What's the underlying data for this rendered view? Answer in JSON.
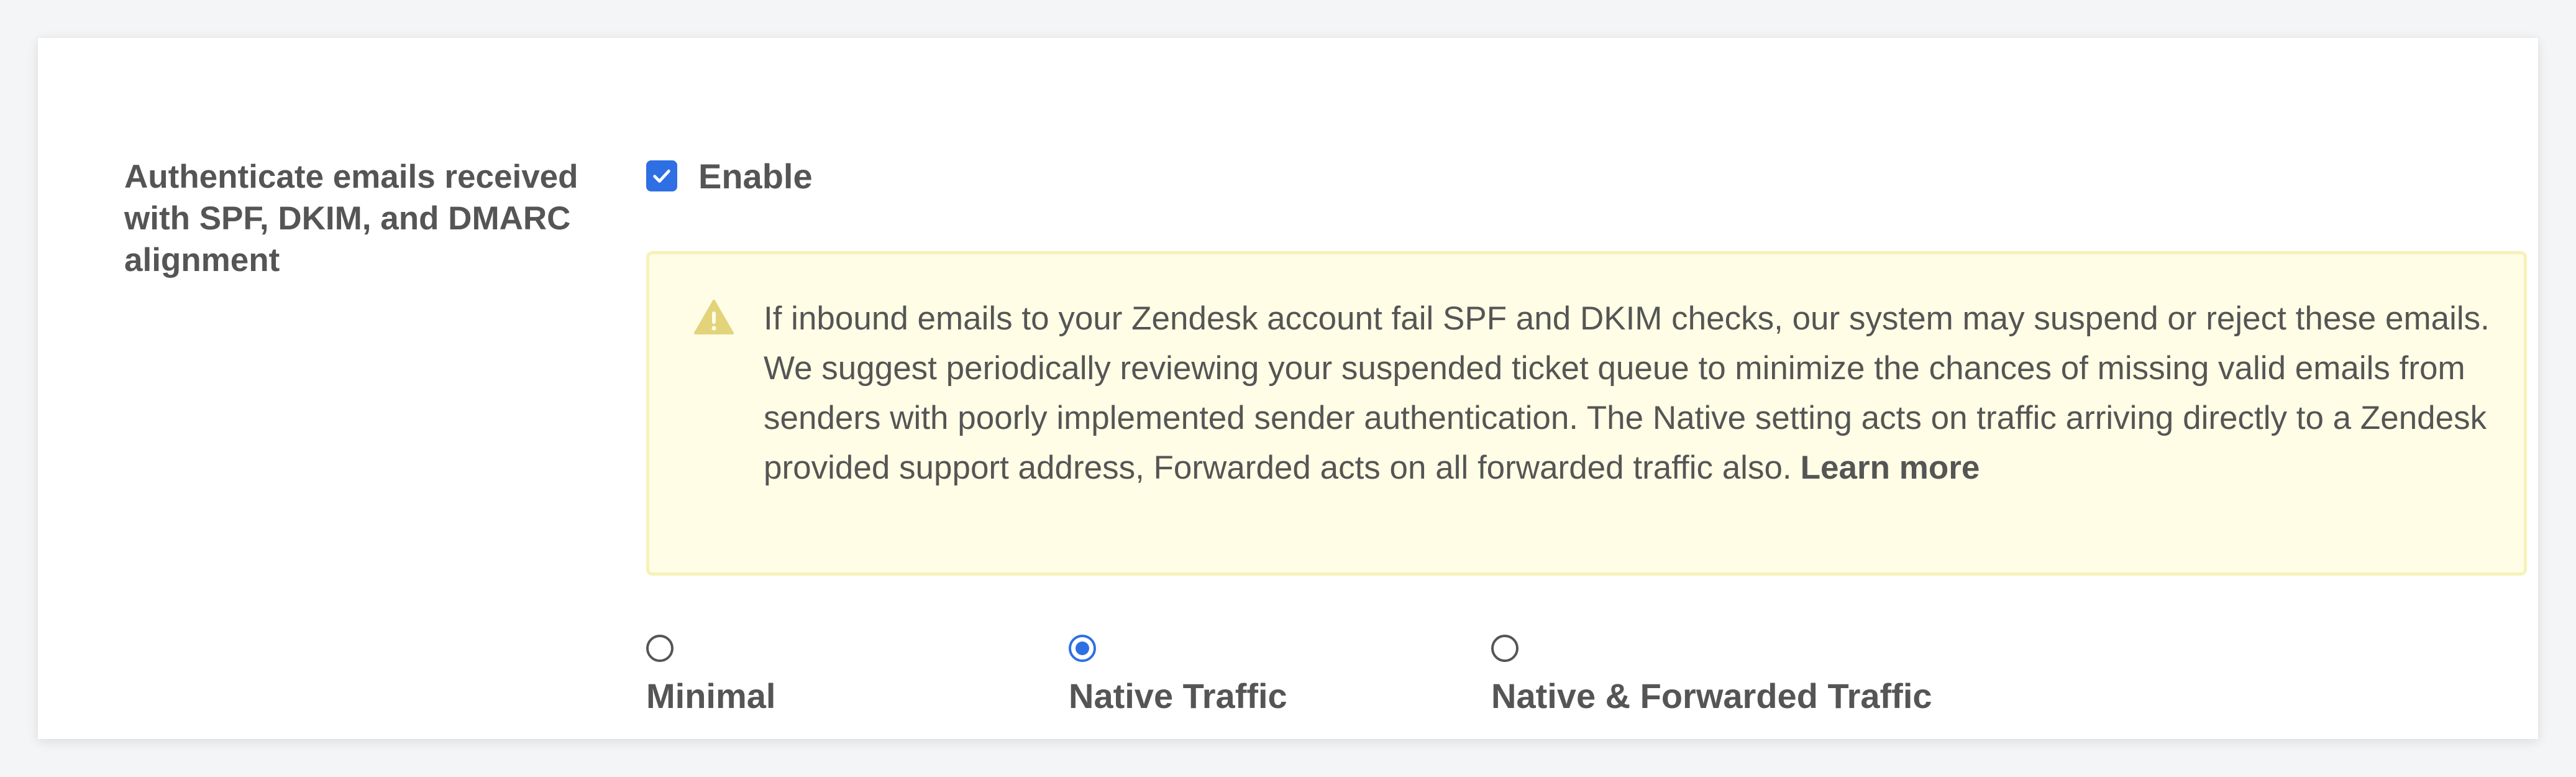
{
  "setting": {
    "label": "Authenticate emails received with SPF, DKIM, and DMARC alignment",
    "enable_label": "Enable",
    "enable_checked": true
  },
  "notice": {
    "icon": "warning-icon",
    "text": "If inbound emails to your Zendesk account fail SPF and DKIM checks, our system may suspend or reject these emails. We suggest periodically reviewing your suspended ticket queue to minimize the chances of missing valid emails from senders with poorly implemented sender authentication. The Native setting acts on traffic arriving directly to a Zendesk provided support address, Forwarded acts on all forwarded traffic also.",
    "link_label": "Learn more"
  },
  "options": [
    {
      "label": "Minimal",
      "selected": false
    },
    {
      "label": "Native Traffic",
      "selected": true
    },
    {
      "label": "Native & Forwarded Traffic",
      "selected": false
    }
  ],
  "colors": {
    "accent": "#2f6fe4",
    "notice_bg": "#fffde6",
    "notice_border": "#f6f2b8",
    "warning_icon": "#e3d37a",
    "text": "#555555"
  }
}
